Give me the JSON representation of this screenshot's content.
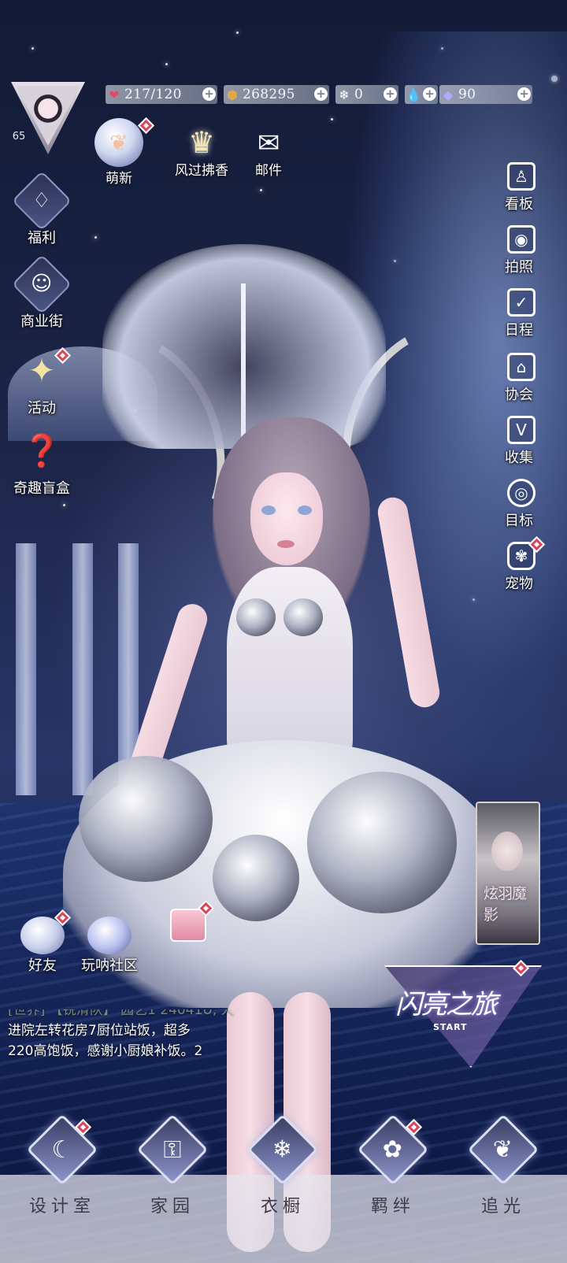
{
  "player": {
    "level": "65"
  },
  "resources": [
    {
      "icon": "heart-gem-icon",
      "value": "217/120",
      "color": "#e04a6a"
    },
    {
      "icon": "gold-coin-icon",
      "value": "268295",
      "color": "#e0a84a"
    },
    {
      "icon": "snowflake-crystal-icon",
      "value": "0",
      "color": "#ffffff"
    },
    {
      "icon": "pearl-drop-icon",
      "value": "",
      "color": "#dfe6ff"
    },
    {
      "icon": "diamond-icon",
      "value": "90",
      "color": "#b6a8ff"
    }
  ],
  "top_icons": {
    "newbie": {
      "label": "萌新",
      "icon": "crystal-ball-butterfly-icon"
    },
    "event": {
      "label": "风过拂香",
      "icon": "crown-icon"
    },
    "mail": {
      "label": "邮件",
      "icon": "envelope-icon"
    }
  },
  "left_nav": [
    {
      "label": "福利",
      "icon": "hot-air-balloon-icon",
      "badge": false
    },
    {
      "label": "商业街",
      "icon": "shopping-bag-icon",
      "badge": false
    },
    {
      "label": "活动",
      "icon": "star-event-icon",
      "badge": true
    },
    {
      "label": "奇趣盲盒",
      "icon": "mystery-box-icon",
      "badge": false
    }
  ],
  "right_nav": [
    {
      "label": "看板",
      "icon": "figure-board-icon",
      "glyph": "♙",
      "badge": false
    },
    {
      "label": "拍照",
      "icon": "camera-icon",
      "glyph": "◉",
      "badge": false
    },
    {
      "label": "日程",
      "icon": "calendar-check-icon",
      "glyph": "✓",
      "badge": false
    },
    {
      "label": "协会",
      "icon": "guild-building-icon",
      "glyph": "⌂",
      "badge": false
    },
    {
      "label": "收集",
      "icon": "collection-v-icon",
      "glyph": "V",
      "badge": false
    },
    {
      "label": "目标",
      "icon": "target-icon",
      "glyph": "◎",
      "badge": false
    },
    {
      "label": "宠物",
      "icon": "paw-icon",
      "glyph": "✾",
      "badge": true
    }
  ],
  "event_card": {
    "title": "炫羽魔影"
  },
  "social": [
    {
      "label": "好友",
      "icon": "friends-bubble-icon",
      "badge": true
    },
    {
      "label": "玩呐社区",
      "icon": "planet-community-icon",
      "badge": false
    }
  ],
  "gift": {
    "icon": "gift-box-icon",
    "badge": true
  },
  "chat": {
    "lines": [
      "[世界] 【锐滑队】 园艺1 24041U, 人",
      "进院左转花房7厨位站饭，超多",
      "220高饱饭，感谢小厨娘补饭。2"
    ]
  },
  "start_banner": {
    "title": "闪亮之旅",
    "subtitle": "START"
  },
  "bottom_nav": [
    {
      "label": "设计室",
      "icon": "moon-design-icon",
      "glyph": "☾",
      "badge": true
    },
    {
      "label": "家园",
      "icon": "key-home-icon",
      "glyph": "⚿",
      "badge": false
    },
    {
      "label": "衣橱",
      "icon": "snowflake-wardrobe-icon",
      "glyph": "❄",
      "badge": false
    },
    {
      "label": "羁绊",
      "icon": "flower-bond-icon",
      "glyph": "✿",
      "badge": true
    },
    {
      "label": "追光",
      "icon": "butterfly-icon",
      "glyph": "❦",
      "badge": false
    }
  ]
}
